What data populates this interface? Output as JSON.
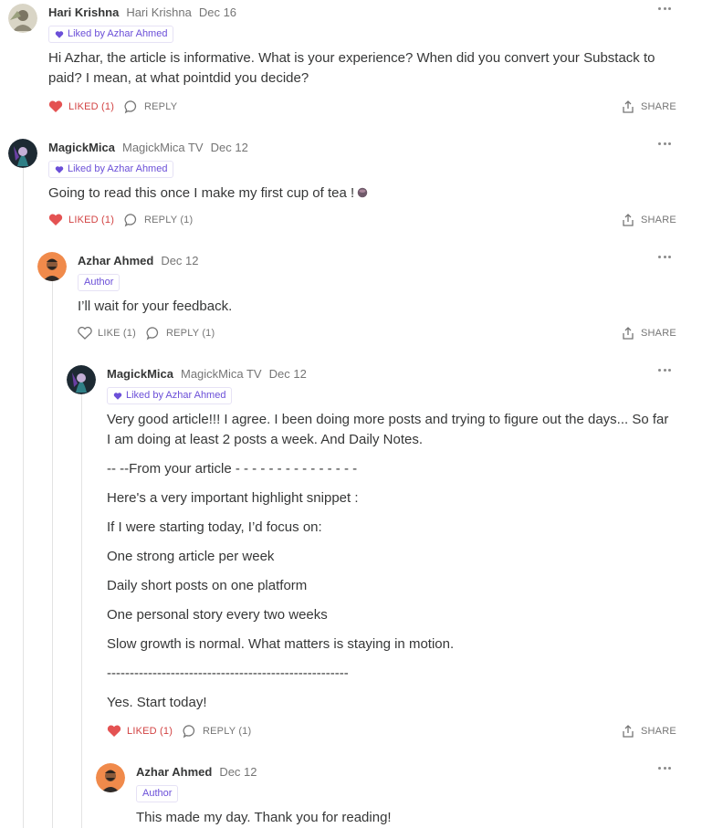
{
  "comments": {
    "c1": {
      "name": "Hari Krishna",
      "handle": "Hari Krishna",
      "date": "Dec 16",
      "badge": "Liked by Azhar Ahmed",
      "text": "Hi Azhar, the article is informative. What is your experience? When did you convert your Substack to paid? I mean, at what pointdid you decide?",
      "like_label": "LIKED (1)",
      "reply_label": "REPLY",
      "share_label": "SHARE"
    },
    "c2": {
      "name": "MagickMica",
      "handle": "MagickMica TV",
      "date": "Dec 12",
      "badge": "Liked by Azhar Ahmed",
      "text": "Going to read this once I make my first cup of tea !",
      "like_label": "LIKED (1)",
      "reply_label": "REPLY (1)",
      "share_label": "SHARE"
    },
    "c3": {
      "name": "Azhar Ahmed",
      "date": "Dec 12",
      "badge": "Author",
      "text": "I’ll wait for your feedback.",
      "like_label": "LIKE (1)",
      "reply_label": "REPLY (1)",
      "share_label": "SHARE"
    },
    "c4": {
      "name": "MagickMica",
      "handle": "MagickMica TV",
      "date": "Dec 12",
      "badge": "Liked by Azhar Ahmed",
      "paragraphs": [
        "Very good article!!! I agree. I been doing more posts and trying to figure out the days... So far I am doing at least 2 posts a week. And Daily Notes.",
        "-- --From your article - - - - - - - - - - - - - - -",
        "Here's a very important highlight snippet :",
        "If I were starting today, I’d focus on:",
        "One strong article per week",
        "Daily short posts on one platform",
        "One personal story every two weeks",
        "Slow growth is normal. What matters is staying in motion.",
        "-----------------------------------------------------",
        "Yes. Start today!"
      ],
      "like_label": "LIKED (1)",
      "reply_label": "REPLY (1)",
      "share_label": "SHARE"
    },
    "c5": {
      "name": "Azhar Ahmed",
      "date": "Dec 12",
      "badge": "Author",
      "text": "This made my day. Thank you for reading!"
    }
  },
  "colors": {
    "liked": "#d24343",
    "badge_purple": "#6b4fd8",
    "muted": "#757575",
    "thread_line": "#e3e3e3"
  },
  "icons": [
    "heart-filled-icon",
    "heart-outline-icon",
    "comment-bubble-icon",
    "share-icon",
    "more-dots-icon",
    "heart-badge-icon",
    "tea-cup-emoji"
  ]
}
